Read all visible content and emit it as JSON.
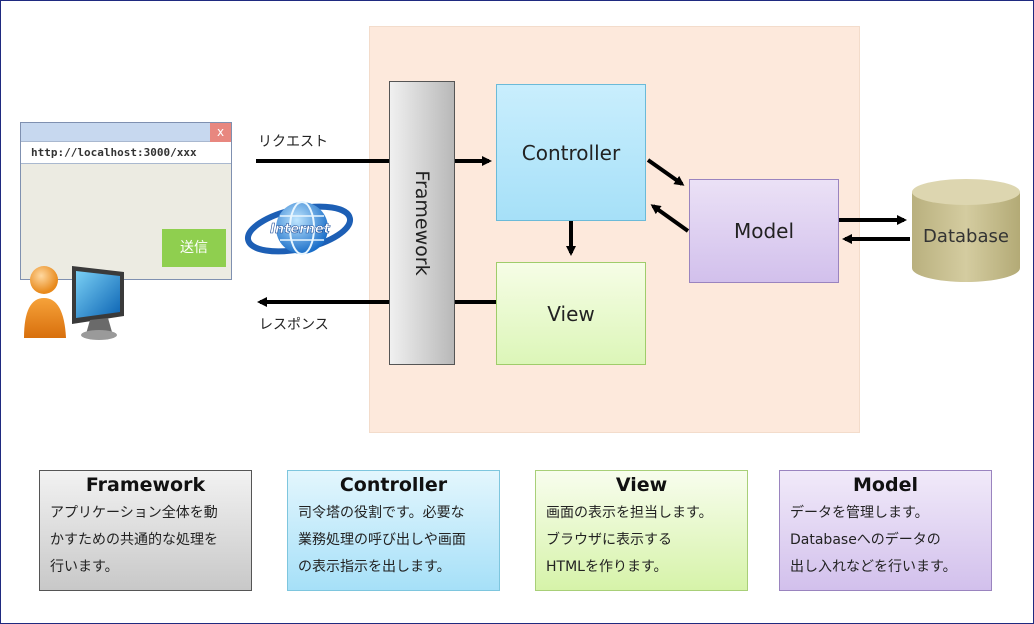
{
  "browser": {
    "close_label": "x",
    "url": "http://localhost:3000/xxx",
    "send_button": "送信"
  },
  "labels": {
    "request": "リクエスト",
    "response": "レスポンス",
    "internet": "Internet"
  },
  "diagram": {
    "framework": "Framework",
    "controller": "Controller",
    "view": "View",
    "model": "Model",
    "database": "Database"
  },
  "cards": [
    {
      "title": "Framework",
      "body": "アプリケーション全体を動\nかすための共通的な処理を\n行います。"
    },
    {
      "title": "Controller",
      "body": "司令塔の役割です。必要な\n業務処理の呼び出しや画面\nの表示指示を出します。"
    },
    {
      "title": "View",
      "body": "画面の表示を担当します。\nブラウザに表示する\nHTMLを作ります。"
    },
    {
      "title": "Model",
      "body": "データを管理します。\nDatabaseへのデータの\n出し入れなどを行います。"
    }
  ],
  "colors": {
    "frame_border": "#1f2a80",
    "app_area": "#fde9dc",
    "controller": "#a6e0f8",
    "view": "#dcf6b8",
    "model": "#d2c0ec",
    "database": "#cfc79a",
    "send_button": "#8fcf4f"
  }
}
